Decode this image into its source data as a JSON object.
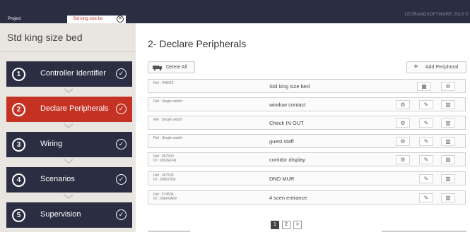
{
  "tabs": {
    "project": "Project",
    "active": "Std king size be",
    "close_glyph": "⊗"
  },
  "brand": "LEGRANDSOFTWARE 2013 ©",
  "sidebar": {
    "title": "Std king size bed",
    "steps": [
      {
        "num": "1",
        "label": "Controller Identifier"
      },
      {
        "num": "2",
        "label": "Declare Peripherals"
      },
      {
        "num": "3",
        "label": "Wiring"
      },
      {
        "num": "4",
        "label": "Scenarios"
      },
      {
        "num": "5",
        "label": "Supervision"
      }
    ],
    "check_glyph": "✓"
  },
  "main": {
    "title": "2- Declare Peripherals",
    "delete_all": "Delete All",
    "add_peripheral": "Add Peripheral",
    "rows": [
      {
        "ref": "Ref : 048412",
        "id": "",
        "name": "Std king size bed"
      },
      {
        "ref": "Ref : Single switch",
        "id": "",
        "name": "window contact"
      },
      {
        "ref": "Ref : Single switch",
        "id": "",
        "name": "Check IN OUT"
      },
      {
        "ref": "Ref : Single switch",
        "id": "",
        "name": "guest staff"
      },
      {
        "ref": "Ref : 067590",
        "id": "ID : 0063ED41",
        "name": "corridor display"
      },
      {
        "ref": "Ref : 067593",
        "id": "ID : 00867858",
        "name": "DND MUR"
      },
      {
        "ref": "Ref : 574504",
        "id": "ID : 00EF0A89",
        "name": "4 scen entrance"
      }
    ],
    "icons": {
      "gear": "⚙",
      "pencil": "✎",
      "trash": "🗑",
      "grid": "▦"
    }
  },
  "pagination": [
    "1",
    "2",
    ">"
  ]
}
